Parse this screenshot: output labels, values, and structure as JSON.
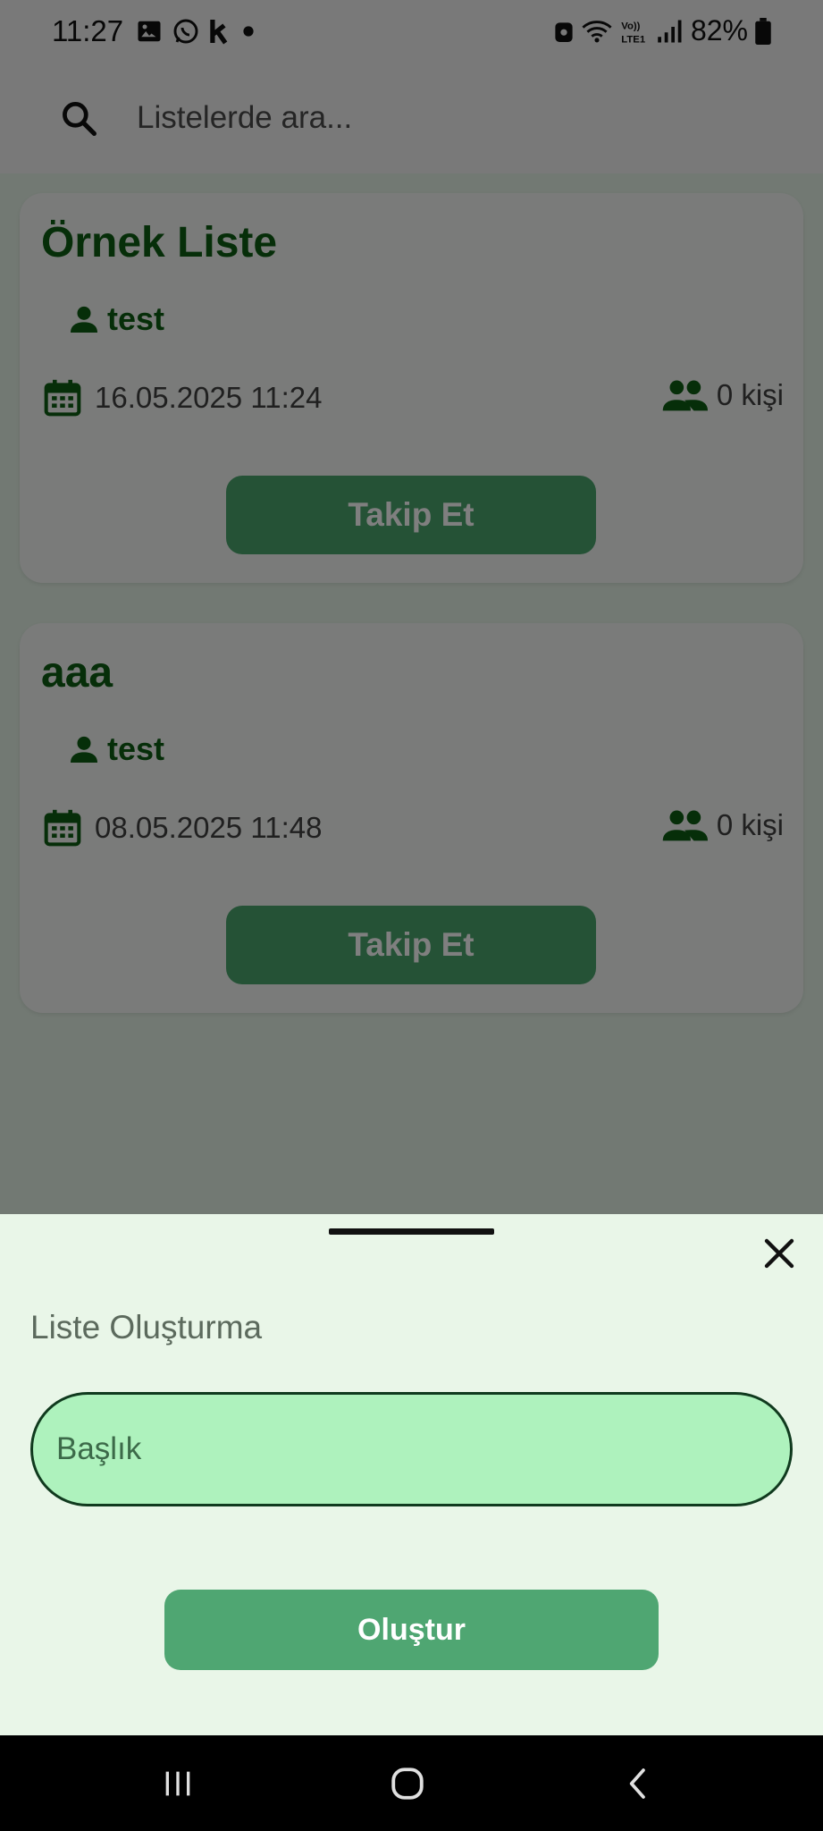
{
  "status_bar": {
    "time": "11:27",
    "battery": "82%"
  },
  "search": {
    "placeholder": "Listelerde ara..."
  },
  "lists": [
    {
      "title": "Örnek Liste",
      "owner": "test",
      "date": "16.05.2025 11:24",
      "followers": "0 kişi",
      "follow_label": "Takip Et"
    },
    {
      "title": "aaa",
      "owner": "test",
      "date": "08.05.2025 11:48",
      "followers": "0 kişi",
      "follow_label": "Takip Et"
    }
  ],
  "sheet": {
    "title": "Liste Oluşturma",
    "title_field_placeholder": "Başlık",
    "create_label": "Oluştur"
  },
  "icons": {
    "search": "search-icon",
    "owner": "person-icon",
    "date": "calendar-icon",
    "followers": "group-icon",
    "close": "close-icon"
  },
  "colors": {
    "accent_green": "#4aa46d",
    "title_green": "#0d5c12",
    "sheet_background": "#e9f6e8",
    "input_fill": "#aef2bd"
  }
}
